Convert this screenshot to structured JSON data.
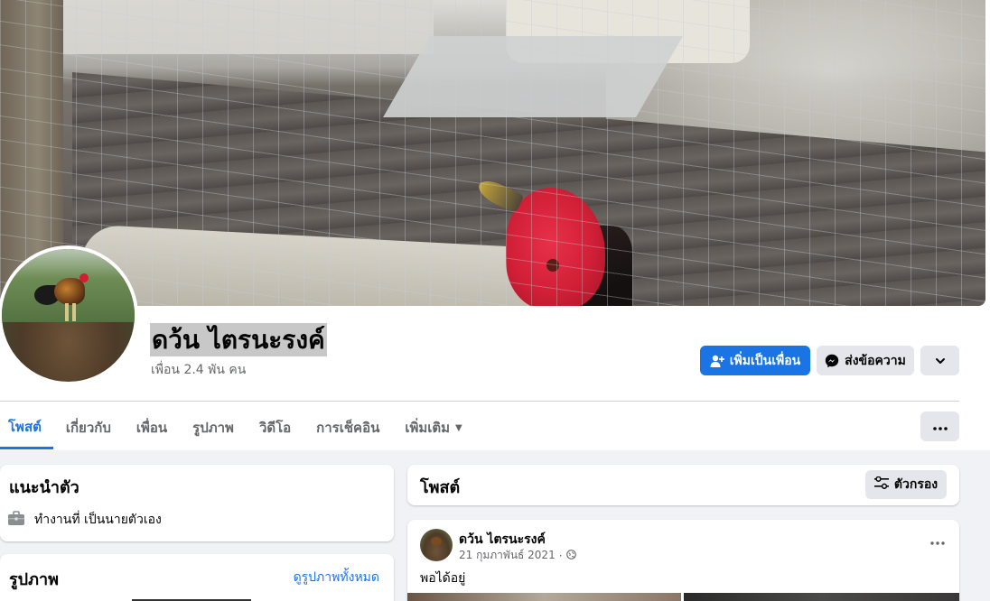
{
  "profile": {
    "name": "ดว้น ไตรนะรงค์",
    "friends": "เพื่อน 2.4 พัน คน"
  },
  "actions": {
    "add_friend": "เพิ่มเป็นเพื่อน",
    "message": "ส่งข้อความ"
  },
  "tabs": [
    {
      "label": "โพสต์",
      "active": true
    },
    {
      "label": "เกี่ยวกับ",
      "active": false
    },
    {
      "label": "เพื่อน",
      "active": false
    },
    {
      "label": "รูปภาพ",
      "active": false
    },
    {
      "label": "วิดีโอ",
      "active": false
    },
    {
      "label": "การเช็คอิน",
      "active": false
    },
    {
      "label": "เพิ่มเติม",
      "active": false
    }
  ],
  "intro": {
    "title": "แนะนำตัว",
    "work": "ทำงานที่ เป็นนายตัวเอง"
  },
  "photos": {
    "title": "รูปภาพ",
    "see_all": "ดูรูปภาพทั้งหมด"
  },
  "posts": {
    "title": "โพสต์",
    "filter": "ตัวกรอง"
  },
  "post": {
    "author": "ดว้น ไตรนะรงค์",
    "date": "21 กุมภาพันธ์ 2021",
    "separator": "·",
    "text": "พอได้อยู่"
  },
  "icons": {
    "add_friend": "person-plus-icon",
    "message": "messenger-icon",
    "more": "chevron-down-icon",
    "tab_more": "caret-down-icon",
    "dots": "ellipsis-icon",
    "work": "briefcase-icon",
    "filter": "sliders-icon",
    "audience": "globe-icon"
  },
  "colors": {
    "accent": "#1b74e4",
    "secondary_button": "#e4e6eb",
    "background": "#f0f2f5",
    "muted_text": "#65676b"
  }
}
